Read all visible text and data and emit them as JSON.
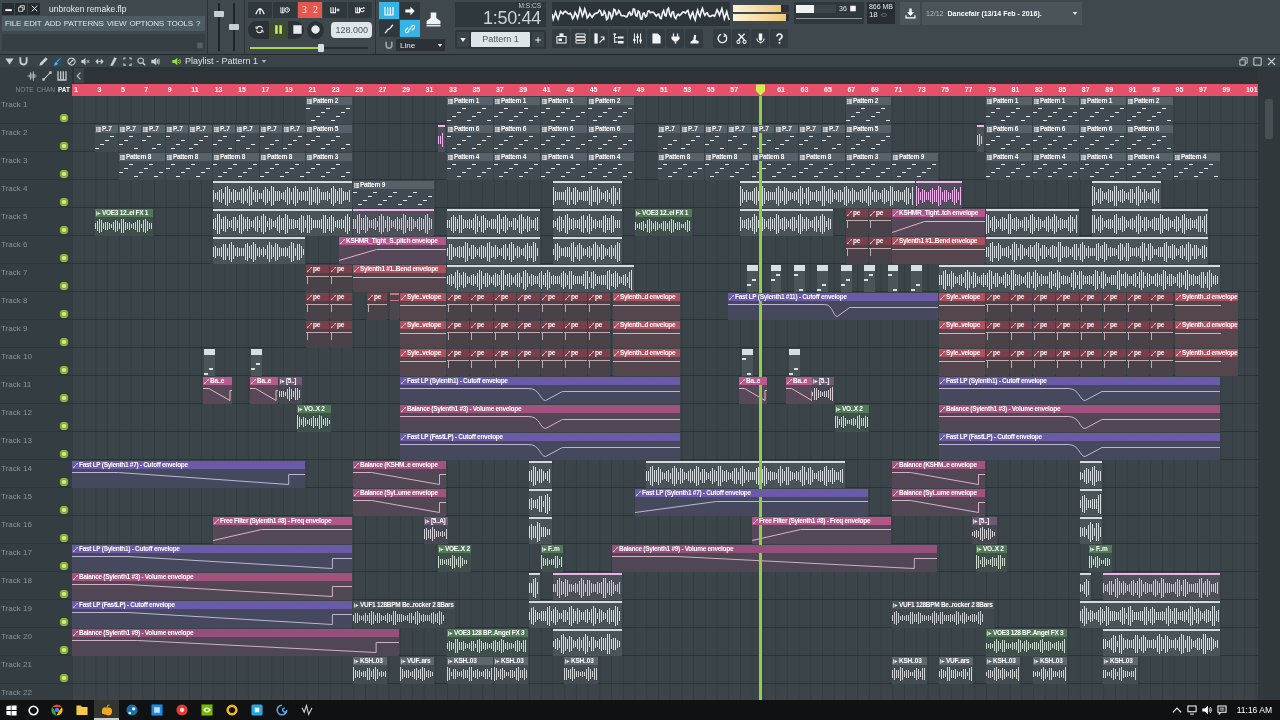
{
  "window": {
    "title": "unbroken remake.flp"
  },
  "menu": [
    "FILE",
    "EDIT",
    "ADD",
    "PATTERNS",
    "VIEW",
    "OPTIONS",
    "TOOLS",
    "?"
  ],
  "master_sliders": [
    {
      "level": 0.8
    },
    {
      "level": 0.5
    }
  ],
  "record_options": [
    {
      "kind": "metronome",
      "on": false
    },
    {
      "kind": "wait",
      "on": false
    },
    {
      "kind": "countdown",
      "label": "3 2",
      "on": true
    },
    {
      "kind": "step",
      "on": false
    },
    {
      "kind": "loop",
      "on": false
    }
  ],
  "transport": {
    "playing": true,
    "recording": false,
    "tempo": "128.000"
  },
  "position_slider": {
    "level": 0.6
  },
  "input_toggles": [
    {
      "kind": "keyboard",
      "on": true
    },
    {
      "kind": "arrow",
      "on": false
    },
    {
      "kind": "squiggle",
      "on": false
    },
    {
      "kind": "link",
      "on": true
    }
  ],
  "snap": {
    "value": "Line"
  },
  "time": {
    "value": "1:50:44",
    "format": "M:S:CS"
  },
  "pattern_selector": {
    "value": "Pattern 1"
  },
  "peak_meters": [
    {
      "level": 0.86
    },
    {
      "level": 0.94
    }
  ],
  "cpu": {
    "level": 0.45,
    "reading": "36"
  },
  "memory": "866 MB",
  "polyphony": "18",
  "news": {
    "counter": "12/12",
    "headline": "Dancefair (13/14 Feb - 2016)."
  },
  "playlist": {
    "title": "Playlist - Pattern 1",
    "tools": [
      {
        "kind": "pencil",
        "selected": false
      },
      {
        "kind": "brush",
        "selected": true
      },
      {
        "kind": "delete",
        "selected": false
      },
      {
        "kind": "mute",
        "selected": false
      },
      {
        "kind": "slip",
        "selected": false
      },
      {
        "kind": "slice",
        "selected": false
      },
      {
        "kind": "select",
        "selected": false
      },
      {
        "kind": "zoom",
        "selected": false
      },
      {
        "kind": "playback",
        "selected": false
      }
    ]
  },
  "clip_filters": [
    {
      "label": "NOTE",
      "selected": false
    },
    {
      "label": "CHAN",
      "selected": false
    },
    {
      "label": "PAT",
      "selected": true
    }
  ],
  "ruler": [
    "1",
    "3",
    "5",
    "7",
    "9",
    "11",
    "13",
    "15",
    "17",
    "19",
    "21",
    "23",
    "25",
    "27",
    "29",
    "31",
    "33",
    "35",
    "37",
    "39",
    "41",
    "43",
    "45",
    "47",
    "49",
    "51",
    "53",
    "55",
    "57",
    "61",
    "63",
    "65",
    "67",
    "69",
    "71",
    "73",
    "75",
    "77",
    "79",
    "81",
    "83",
    "85",
    "87",
    "89",
    "91",
    "93",
    "95",
    "97",
    "99",
    "101"
  ],
  "playhead": {
    "level": 0.58
  },
  "tracks": [
    {
      "name": "Track 1",
      "enabled": true,
      "clips": [
        {
          "kind": "pattern",
          "label": "Pattern 2",
          "color": "#56616a"
        },
        {
          "kind": "pattern",
          "label": "Pattern 1",
          "color": "#56616a"
        },
        {
          "kind": "pattern",
          "label": "Pattern 1",
          "color": "#56616a"
        },
        {
          "kind": "pattern",
          "label": "Pattern 1",
          "color": "#56616a"
        },
        {
          "kind": "pattern",
          "label": "Pattern 2",
          "color": "#56616a"
        },
        {
          "kind": "pattern",
          "label": "Pattern 2",
          "color": "#56616a"
        },
        {
          "kind": "pattern",
          "label": "Pattern 1",
          "color": "#56616a"
        },
        {
          "kind": "pattern",
          "label": "Pattern 1",
          "color": "#56616a"
        },
        {
          "kind": "pattern",
          "label": "Pattern 1",
          "color": "#56616a"
        },
        {
          "kind": "pattern",
          "label": "Pattern 2",
          "color": "#56616a"
        }
      ]
    },
    {
      "name": "Track 2",
      "enabled": true,
      "clips": [
        {
          "kind": "pattern",
          "label": "P..7",
          "color": "#56616a"
        },
        {
          "kind": "pattern",
          "label": "P..7",
          "color": "#56616a"
        },
        {
          "kind": "pattern",
          "label": "P..7",
          "color": "#56616a"
        },
        {
          "kind": "pattern",
          "label": "P..7",
          "color": "#56616a"
        },
        {
          "kind": "pattern",
          "label": "P..7",
          "color": "#56616a"
        },
        {
          "kind": "pattern",
          "label": "P..7",
          "color": "#56616a"
        },
        {
          "kind": "pattern",
          "label": "P..7",
          "color": "#56616a"
        },
        {
          "kind": "pattern",
          "label": "P..7",
          "color": "#56616a"
        },
        {
          "kind": "pattern",
          "label": "P..7",
          "color": "#56616a"
        },
        {
          "kind": "pattern",
          "label": "Pattern 5",
          "color": "#56616a"
        },
        {
          "kind": "audio",
          "color": "#f0b0ec"
        },
        {
          "kind": "pattern",
          "label": "Pattern 6",
          "color": "#56616a"
        },
        {
          "kind": "pattern",
          "label": "Pattern 6",
          "color": "#56616a"
        },
        {
          "kind": "pattern",
          "label": "Pattern 6",
          "color": "#56616a"
        },
        {
          "kind": "pattern",
          "label": "Pattern 6",
          "color": "#56616a"
        },
        {
          "kind": "pattern",
          "label": "P..7",
          "color": "#56616a"
        },
        {
          "kind": "pattern",
          "label": "P..7",
          "color": "#56616a"
        },
        {
          "kind": "pattern",
          "label": "P..7",
          "color": "#56616a"
        },
        {
          "kind": "pattern",
          "label": "P..7",
          "color": "#56616a"
        },
        {
          "kind": "pattern",
          "label": "P..7",
          "color": "#56616a"
        },
        {
          "kind": "pattern",
          "label": "P..7",
          "color": "#56616a"
        },
        {
          "kind": "pattern",
          "label": "P..7",
          "color": "#56616a"
        },
        {
          "kind": "pattern",
          "label": "P..7",
          "color": "#56616a"
        },
        {
          "kind": "pattern",
          "label": "Pattern 5",
          "color": "#56616a"
        },
        {
          "kind": "audio",
          "color": "#f0b0ec"
        },
        {
          "kind": "pattern",
          "label": "Pattern 6",
          "color": "#56616a"
        },
        {
          "kind": "pattern",
          "label": "Pattern 6",
          "color": "#56616a"
        },
        {
          "kind": "pattern",
          "label": "Pattern 6",
          "color": "#56616a"
        },
        {
          "kind": "pattern",
          "label": "Pattern 6",
          "color": "#56616a"
        }
      ]
    },
    {
      "name": "Track 3",
      "enabled": true,
      "clips": [
        {
          "kind": "pattern",
          "label": "Pattern 8",
          "color": "#56616a"
        },
        {
          "kind": "pattern",
          "label": "Pattern 8",
          "color": "#56616a"
        },
        {
          "kind": "pattern",
          "label": "Pattern 8",
          "color": "#56616a"
        },
        {
          "kind": "pattern",
          "label": "Pattern 8",
          "color": "#56616a"
        },
        {
          "kind": "pattern",
          "label": "Pattern 3",
          "color": "#56616a"
        },
        {
          "kind": "pattern",
          "label": "Pattern 4",
          "color": "#56616a"
        },
        {
          "kind": "pattern",
          "label": "Pattern 4",
          "color": "#56616a"
        },
        {
          "kind": "pattern",
          "label": "Pattern 4",
          "color": "#56616a"
        },
        {
          "kind": "pattern",
          "label": "Pattern 4",
          "color": "#56616a"
        },
        {
          "kind": "pattern",
          "label": "Pattern 8",
          "color": "#56616a"
        },
        {
          "kind": "pattern",
          "label": "Pattern 8",
          "color": "#56616a"
        },
        {
          "kind": "pattern",
          "label": "Pattern 8",
          "color": "#56616a"
        },
        {
          "kind": "pattern",
          "label": "Pattern 8",
          "color": "#56616a"
        },
        {
          "kind": "pattern",
          "label": "Pattern 3",
          "color": "#56616a"
        },
        {
          "kind": "pattern",
          "label": "Pattern 9",
          "color": "#56616a"
        },
        {
          "kind": "pattern",
          "label": "Pattern 4",
          "color": "#56616a"
        },
        {
          "kind": "pattern",
          "label": "Pattern 4",
          "color": "#56616a"
        },
        {
          "kind": "pattern",
          "label": "Pattern 4",
          "color": "#56616a"
        },
        {
          "kind": "pattern",
          "label": "Pattern 4",
          "color": "#56616a"
        },
        {
          "kind": "pattern",
          "label": "Pattern 4",
          "color": "#56616a"
        }
      ]
    },
    {
      "name": "Track 4",
      "enabled": true,
      "clips": [
        {
          "kind": "audio",
          "color": "#d4dbdf"
        },
        {
          "kind": "pattern",
          "label": "Pattern 9",
          "color": "#56616a"
        },
        {
          "kind": "audio",
          "color": "#d4dbdf"
        },
        {
          "kind": "audio",
          "color": "#d4dbdf"
        },
        {
          "kind": "audio",
          "color": "#f0b0ec"
        },
        {
          "kind": "audio",
          "color": "#d4dbdf"
        }
      ]
    },
    {
      "name": "Track 5",
      "enabled": true,
      "clips": [
        {
          "kind": "audio",
          "label": "VOE3 12..el FX 1",
          "color": "#4f7a55"
        },
        {
          "kind": "audio",
          "color": "#d4dbdf"
        },
        {
          "kind": "audio",
          "color": "#f0b0ec"
        },
        {
          "kind": "audio",
          "color": "#d4dbdf"
        },
        {
          "kind": "audio",
          "color": "#d4dbdf"
        },
        {
          "kind": "audio",
          "label": "VOE3 12..el FX 1",
          "color": "#4f7a55"
        },
        {
          "kind": "audio",
          "color": "#d4dbdf"
        },
        {
          "kind": "automation",
          "label": "pe",
          "color": "#7a3f4a"
        },
        {
          "kind": "automation",
          "label": "pe",
          "color": "#7a3f4a"
        },
        {
          "kind": "automation",
          "label": "KSHMR_Tight..tch envelope",
          "color": "#b5568e"
        },
        {
          "kind": "audio",
          "color": "#d4dbdf"
        },
        {
          "kind": "audio",
          "color": "#d4dbdf"
        }
      ]
    },
    {
      "name": "Track 6",
      "enabled": true,
      "clips": [
        {
          "kind": "audio",
          "color": "#d4dbdf"
        },
        {
          "kind": "automation",
          "label": "KSHMR_Tight_S..pitch envelope",
          "color": "#b5568e"
        },
        {
          "kind": "audio",
          "color": "#d4dbdf"
        },
        {
          "kind": "audio",
          "color": "#d4dbdf"
        },
        {
          "kind": "automation",
          "label": "pe",
          "color": "#7a3f4a"
        },
        {
          "kind": "automation",
          "label": "pe",
          "color": "#7a3f4a"
        },
        {
          "kind": "automation",
          "label": "Sylenth1 #1..Bend envelope",
          "color": "#b24f5f"
        },
        {
          "kind": "audio",
          "color": "#d4dbdf"
        }
      ]
    },
    {
      "name": "Track 7",
      "enabled": true,
      "clips": [
        {
          "kind": "automation",
          "label": "pe",
          "color": "#7a3f4a"
        },
        {
          "kind": "automation",
          "label": "pe",
          "color": "#7a3f4a"
        },
        {
          "kind": "automation",
          "label": "Sylenth1 #1..Bend envelope",
          "color": "#b24f5f"
        },
        {
          "kind": "audio",
          "color": "#d4dbdf"
        },
        {
          "kind": "pattern",
          "color": "#d8dfe3"
        },
        {
          "kind": "pattern",
          "color": "#d8dfe3"
        },
        {
          "kind": "pattern",
          "color": "#d8dfe3"
        },
        {
          "kind": "pattern",
          "color": "#d8dfe3"
        },
        {
          "kind": "pattern",
          "color": "#d8dfe3"
        },
        {
          "kind": "pattern",
          "color": "#d8dfe3"
        },
        {
          "kind": "pattern",
          "color": "#d8dfe3"
        },
        {
          "kind": "pattern",
          "color": "#d8dfe3"
        },
        {
          "kind": "audio",
          "color": "#d4dbdf"
        }
      ]
    },
    {
      "name": "Track 8",
      "enabled": true,
      "clips": [
        {
          "kind": "automation",
          "label": "pe",
          "color": "#7a3f4a"
        },
        {
          "kind": "automation",
          "label": "pe",
          "color": "#7a3f4a"
        },
        {
          "kind": "automation",
          "label": "pe",
          "color": "#7a3f4a"
        },
        {
          "kind": "automation",
          "color": "#d0707e"
        },
        {
          "kind": "automation",
          "label": "Syle..velope",
          "color": "#b24f5f"
        },
        {
          "kind": "automation",
          "label": "pe",
          "color": "#7a3f4a"
        },
        {
          "kind": "automation",
          "label": "pe",
          "color": "#7a3f4a"
        },
        {
          "kind": "automation",
          "label": "pe",
          "color": "#7a3f4a"
        },
        {
          "kind": "automation",
          "label": "pe",
          "color": "#7a3f4a"
        },
        {
          "kind": "automation",
          "label": "pe",
          "color": "#7a3f4a"
        },
        {
          "kind": "automation",
          "label": "pe",
          "color": "#7a3f4a"
        },
        {
          "kind": "automation",
          "label": "pe",
          "color": "#7a3f4a"
        },
        {
          "kind": "automation",
          "label": "Sylenth..d envelope",
          "color": "#b24f5f"
        },
        {
          "kind": "automation",
          "label": "Fast LP (Sylenth1 #11) - Cutoff envelope",
          "color": "#6b5aa8"
        },
        {
          "kind": "automation",
          "label": "Syle..velope",
          "color": "#b24f5f"
        },
        {
          "kind": "automation",
          "label": "pe",
          "color": "#7a3f4a"
        },
        {
          "kind": "automation",
          "label": "pe",
          "color": "#7a3f4a"
        },
        {
          "kind": "automation",
          "label": "pe",
          "color": "#7a3f4a"
        },
        {
          "kind": "automation",
          "label": "pe",
          "color": "#7a3f4a"
        },
        {
          "kind": "automation",
          "label": "pe",
          "color": "#7a3f4a"
        },
        {
          "kind": "automation",
          "label": "pe",
          "color": "#7a3f4a"
        },
        {
          "kind": "automation",
          "label": "pe",
          "color": "#7a3f4a"
        },
        {
          "kind": "automation",
          "label": "pe",
          "color": "#7a3f4a"
        },
        {
          "kind": "automation",
          "label": "Sylenth..d envelope",
          "color": "#b24f5f"
        }
      ]
    },
    {
      "name": "Track 9",
      "enabled": true,
      "clips": [
        {
          "kind": "automation",
          "label": "pe",
          "color": "#7a3f4a"
        },
        {
          "kind": "automation",
          "label": "pe",
          "color": "#7a3f4a"
        },
        {
          "kind": "automation",
          "label": "Syle..velope",
          "color": "#b24f5f"
        },
        {
          "kind": "automation",
          "label": "pe",
          "color": "#7a3f4a"
        },
        {
          "kind": "automation",
          "label": "pe",
          "color": "#7a3f4a"
        },
        {
          "kind": "automation",
          "label": "pe",
          "color": "#7a3f4a"
        },
        {
          "kind": "automation",
          "label": "pe",
          "color": "#7a3f4a"
        },
        {
          "kind": "automation",
          "label": "pe",
          "color": "#7a3f4a"
        },
        {
          "kind": "automation",
          "label": "pe",
          "color": "#7a3f4a"
        },
        {
          "kind": "automation",
          "label": "pe",
          "color": "#7a3f4a"
        },
        {
          "kind": "automation",
          "label": "Sylenth..d envelope",
          "color": "#b24f5f"
        },
        {
          "kind": "automation",
          "label": "Syle..velope",
          "color": "#b24f5f"
        },
        {
          "kind": "automation",
          "label": "pe",
          "color": "#7a3f4a"
        },
        {
          "kind": "automation",
          "label": "pe",
          "color": "#7a3f4a"
        },
        {
          "kind": "automation",
          "label": "pe",
          "color": "#7a3f4a"
        },
        {
          "kind": "automation",
          "label": "pe",
          "color": "#7a3f4a"
        },
        {
          "kind": "automation",
          "label": "pe",
          "color": "#7a3f4a"
        },
        {
          "kind": "automation",
          "label": "pe",
          "color": "#7a3f4a"
        },
        {
          "kind": "automation",
          "label": "pe",
          "color": "#7a3f4a"
        },
        {
          "kind": "automation",
          "label": "pe",
          "color": "#7a3f4a"
        },
        {
          "kind": "automation",
          "label": "Sylenth..d envelope",
          "color": "#b24f5f"
        }
      ]
    },
    {
      "name": "Track 10",
      "enabled": true,
      "clips": [
        {
          "kind": "pattern",
          "color": "#d8dfe3"
        },
        {
          "kind": "pattern",
          "color": "#d8dfe3"
        },
        {
          "kind": "automation",
          "label": "Syle..velope",
          "color": "#b24f5f"
        },
        {
          "kind": "automation",
          "label": "pe",
          "color": "#7a3f4a"
        },
        {
          "kind": "automation",
          "label": "pe",
          "color": "#7a3f4a"
        },
        {
          "kind": "automation",
          "label": "pe",
          "color": "#7a3f4a"
        },
        {
          "kind": "automation",
          "label": "pe",
          "color": "#7a3f4a"
        },
        {
          "kind": "automation",
          "label": "pe",
          "color": "#7a3f4a"
        },
        {
          "kind": "automation",
          "label": "pe",
          "color": "#7a3f4a"
        },
        {
          "kind": "automation",
          "label": "pe",
          "color": "#7a3f4a"
        },
        {
          "kind": "automation",
          "label": "Sylenth..d envelope",
          "color": "#b24f5f"
        },
        {
          "kind": "pattern",
          "color": "#d8dfe3"
        },
        {
          "kind": "pattern",
          "color": "#d8dfe3"
        },
        {
          "kind": "automation",
          "label": "Syle..velope",
          "color": "#b24f5f"
        },
        {
          "kind": "automation",
          "label": "pe",
          "color": "#7a3f4a"
        },
        {
          "kind": "automation",
          "label": "pe",
          "color": "#7a3f4a"
        },
        {
          "kind": "automation",
          "label": "pe",
          "color": "#7a3f4a"
        },
        {
          "kind": "automation",
          "label": "pe",
          "color": "#7a3f4a"
        },
        {
          "kind": "automation",
          "label": "pe",
          "color": "#7a3f4a"
        },
        {
          "kind": "automation",
          "label": "pe",
          "color": "#7a3f4a"
        },
        {
          "kind": "automation",
          "label": "pe",
          "color": "#7a3f4a"
        },
        {
          "kind": "automation",
          "label": "pe",
          "color": "#7a3f4a"
        },
        {
          "kind": "automation",
          "label": "Sylenth..d envelope",
          "color": "#b24f5f"
        }
      ]
    },
    {
      "name": "Track 11",
      "enabled": true,
      "clips": [
        {
          "kind": "automation",
          "label": "Ba..e",
          "color": "#b9598e"
        },
        {
          "kind": "automation",
          "label": "Ba..e",
          "color": "#b9598e"
        },
        {
          "kind": "audio",
          "label": "[5..]",
          "color": "#6e5a73"
        },
        {
          "kind": "automation",
          "label": "Fast LP (Sylenth1) - Cutoff envelope",
          "color": "#6b5aa8"
        },
        {
          "kind": "automation",
          "label": "Ba..e",
          "color": "#b9598e"
        },
        {
          "kind": "automation",
          "label": "Ba..e",
          "color": "#b9598e"
        },
        {
          "kind": "audio",
          "label": "[5..]",
          "color": "#6e5a73"
        },
        {
          "kind": "automation",
          "label": "Fast LP (Sylenth1) - Cutoff envelope",
          "color": "#6b5aa8"
        }
      ]
    },
    {
      "name": "Track 12",
      "enabled": true,
      "clips": [
        {
          "kind": "audio",
          "label": "VO..X 2",
          "color": "#4f7a55"
        },
        {
          "kind": "automation",
          "label": "Balance (Sylenth1 #3) - Volume envelope",
          "color": "#a3527f"
        },
        {
          "kind": "audio",
          "label": "VO..X 2",
          "color": "#4f7a55"
        },
        {
          "kind": "automation",
          "label": "Balance (Sylenth1 #3) - Volume envelope",
          "color": "#a3527f"
        }
      ]
    },
    {
      "name": "Track 13",
      "enabled": true,
      "clips": [
        {
          "kind": "automation",
          "label": "Fast LP (FastLP) - Cutoff envelope",
          "color": "#6b5aa8"
        },
        {
          "kind": "automation",
          "label": "Fast LP (FastLP) - Cutoff envelope",
          "color": "#6b5aa8"
        }
      ]
    },
    {
      "name": "Track 14",
      "enabled": true,
      "clips": [
        {
          "kind": "automation",
          "label": "Fast LP (Sylenth1 #7) - Cutoff envelope",
          "color": "#6b5aa8"
        },
        {
          "kind": "automation",
          "label": "Balance (KSHM..e envelope",
          "color": "#a3527f"
        },
        {
          "kind": "audio",
          "color": "#d4dbdf"
        },
        {
          "kind": "audio",
          "color": "#d4dbdf"
        },
        {
          "kind": "automation",
          "label": "Balance (KSHM..e envelope",
          "color": "#a3527f"
        },
        {
          "kind": "audio",
          "color": "#d4dbdf"
        }
      ]
    },
    {
      "name": "Track 15",
      "enabled": true,
      "clips": [
        {
          "kind": "automation",
          "label": "Balance (Syl..ume envelope",
          "color": "#a3527f"
        },
        {
          "kind": "audio",
          "color": "#d4dbdf"
        },
        {
          "kind": "automation",
          "label": "Fast LP (Sylenth1 #7) - Cutoff envelope",
          "color": "#6b5aa8"
        },
        {
          "kind": "automation",
          "label": "Balance (Syl..ume envelope",
          "color": "#a3527f"
        },
        {
          "kind": "audio",
          "color": "#d4dbdf"
        }
      ]
    },
    {
      "name": "Track 16",
      "enabled": true,
      "clips": [
        {
          "kind": "automation",
          "label": "Free Filter (Sylenth1 #8) - Freq envelope",
          "color": "#b3578b"
        },
        {
          "kind": "audio",
          "label": "[5..A]",
          "color": "#6e5a73"
        },
        {
          "kind": "audio",
          "color": "#d4dbdf"
        },
        {
          "kind": "automation",
          "label": "Free Filter (Sylenth1 #8) - Freq envelope",
          "color": "#b3578b"
        },
        {
          "kind": "audio",
          "label": "[5..]",
          "color": "#6e5a73"
        },
        {
          "kind": "audio",
          "color": "#d4dbdf"
        }
      ]
    },
    {
      "name": "Track 17",
      "enabled": true,
      "clips": [
        {
          "kind": "automation",
          "label": "Fast LP (Sylenth1) - Cutoff envelope",
          "color": "#6b5aa8"
        },
        {
          "kind": "audio",
          "label": "VOE..X 2",
          "color": "#4f7a55"
        },
        {
          "kind": "audio",
          "label": "F..m",
          "color": "#4f7a55"
        },
        {
          "kind": "automation",
          "label": "Balance (Sylenth1 #9) - Volume envelope",
          "color": "#94507a"
        },
        {
          "kind": "audio",
          "label": "VO..X 2",
          "color": "#4f7a55"
        },
        {
          "kind": "audio",
          "label": "F..m",
          "color": "#4f7a55"
        }
      ]
    },
    {
      "name": "Track 18",
      "enabled": true,
      "clips": [
        {
          "kind": "automation",
          "label": "Balance (Sylenth1 #3) - Volume envelope",
          "color": "#a3527f"
        },
        {
          "kind": "audio",
          "color": "#d4dbdf"
        },
        {
          "kind": "audio",
          "color": "#f0b0ec"
        },
        {
          "kind": "audio",
          "color": "#d4dbdf"
        },
        {
          "kind": "audio",
          "color": "#f0b0ec"
        }
      ]
    },
    {
      "name": "Track 19",
      "enabled": true,
      "clips": [
        {
          "kind": "automation",
          "label": "Fast LP (FastLP) - Cutoff envelope",
          "color": "#6b5aa8"
        },
        {
          "kind": "audio",
          "label": "VUF1 128BPM Be..rocker 2 8Bars",
          "color": "#4c555a"
        },
        {
          "kind": "audio",
          "color": "#d4dbdf"
        },
        {
          "kind": "audio",
          "label": "VUF1 128BPM Be..rocker 2 8Bars",
          "color": "#4c555a"
        },
        {
          "kind": "audio",
          "color": "#d4dbdf"
        }
      ]
    },
    {
      "name": "Track 20",
      "enabled": true,
      "clips": [
        {
          "kind": "automation",
          "label": "Balance (Sylenth1 #9) - Volume envelope",
          "color": "#94507a"
        },
        {
          "kind": "audio",
          "label": "VOE3 128 BP..Angel FX 3",
          "color": "#4f7a55"
        },
        {
          "kind": "audio",
          "color": "#d4dbdf"
        },
        {
          "kind": "audio",
          "label": "VOE3 128 BP..Angel FX 3",
          "color": "#4f7a55"
        },
        {
          "kind": "audio",
          "color": "#d4dbdf"
        }
      ]
    },
    {
      "name": "Track 21",
      "enabled": true,
      "clips": [
        {
          "kind": "audio",
          "label": "KSH..03",
          "color": "#5e676c"
        },
        {
          "kind": "audio",
          "label": "VUF..ars",
          "color": "#5e676c"
        },
        {
          "kind": "audio",
          "label": "KSH..03",
          "color": "#5e676c"
        },
        {
          "kind": "audio",
          "label": "KSH..03",
          "color": "#5e676c"
        },
        {
          "kind": "audio",
          "label": "KSH..03",
          "color": "#5e676c"
        },
        {
          "kind": "audio",
          "label": "KSH..03",
          "color": "#5e676c"
        },
        {
          "kind": "audio",
          "label": "VUF..ars",
          "color": "#5e676c"
        },
        {
          "kind": "audio",
          "label": "KSH..03",
          "color": "#5e676c"
        },
        {
          "kind": "audio",
          "label": "KSH..03",
          "color": "#5e676c"
        },
        {
          "kind": "audio",
          "label": "KSH..03",
          "color": "#5e676c"
        }
      ]
    },
    {
      "name": "Track 22"
    }
  ],
  "taskbar": {
    "apps": [
      {
        "kind": "circle",
        "selected": false
      },
      {
        "kind": "folder",
        "selected": false
      },
      {
        "kind": "fruit",
        "selected": true
      },
      {
        "kind": "disc",
        "selected": false
      },
      {
        "kind": "tile",
        "selected": false
      },
      {
        "kind": "badge",
        "selected": false
      },
      {
        "kind": "eye",
        "selected": false
      },
      {
        "kind": "ring",
        "selected": false
      },
      {
        "kind": "square",
        "selected": false
      },
      {
        "kind": "swirl",
        "selected": false
      },
      {
        "kind": "scribble",
        "selected": false
      }
    ],
    "clock": "11:16 AM"
  }
}
